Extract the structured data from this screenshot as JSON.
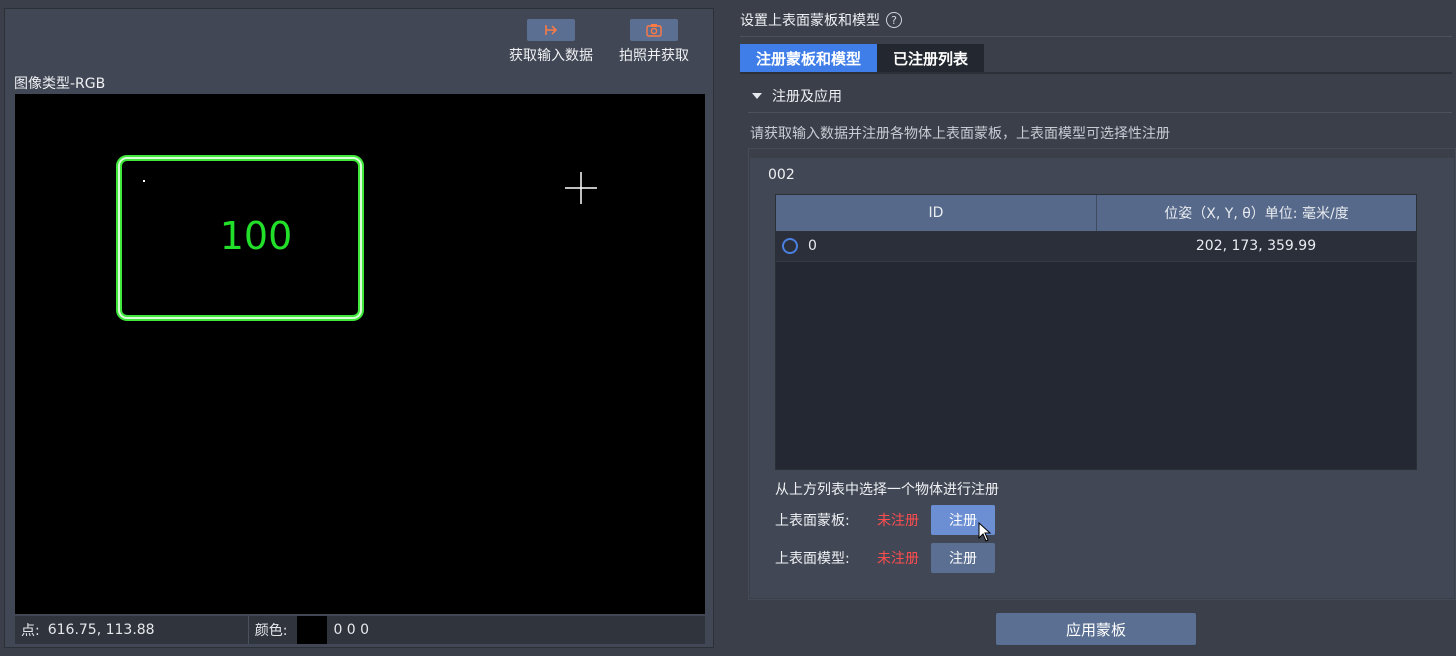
{
  "left": {
    "toolbar": {
      "get_input_label": "获取输入数据",
      "capture_label": "拍照并获取"
    },
    "image_type": "图像类型-RGB",
    "viewer": {
      "detected_text": "100"
    },
    "status": {
      "point_label": "点:",
      "point_value": "616.75, 113.88",
      "color_label": "颜色:",
      "color_value": "0 0 0"
    }
  },
  "right": {
    "title": "设置上表面蒙板和模型",
    "tabs": [
      {
        "label": "注册蒙板和模型",
        "active": true
      },
      {
        "label": "已注册列表",
        "active": false
      }
    ],
    "section_title": "注册及应用",
    "description": "请获取输入数据并注册各物体上表面蒙板，上表面模型可选择性注册",
    "group_name": "002",
    "table": {
      "headers": [
        "ID",
        "位姿（X, Y, θ）单位: 毫米/度"
      ],
      "rows": [
        {
          "id": "0",
          "pose": "202, 173, 359.99"
        }
      ]
    },
    "hint": "从上方列表中选择一个物体进行注册",
    "registrations": [
      {
        "label": "上表面蒙板:",
        "status": "未注册",
        "button": "注册"
      },
      {
        "label": "上表面模型:",
        "status": "未注册",
        "button": "注册"
      }
    ],
    "apply_button": "应用蒙板"
  },
  "colors": {
    "accent": "#3f7ee8",
    "button": "#5a6f92",
    "unregistered": "#ff4d4f",
    "contour": "#3fe83a"
  }
}
